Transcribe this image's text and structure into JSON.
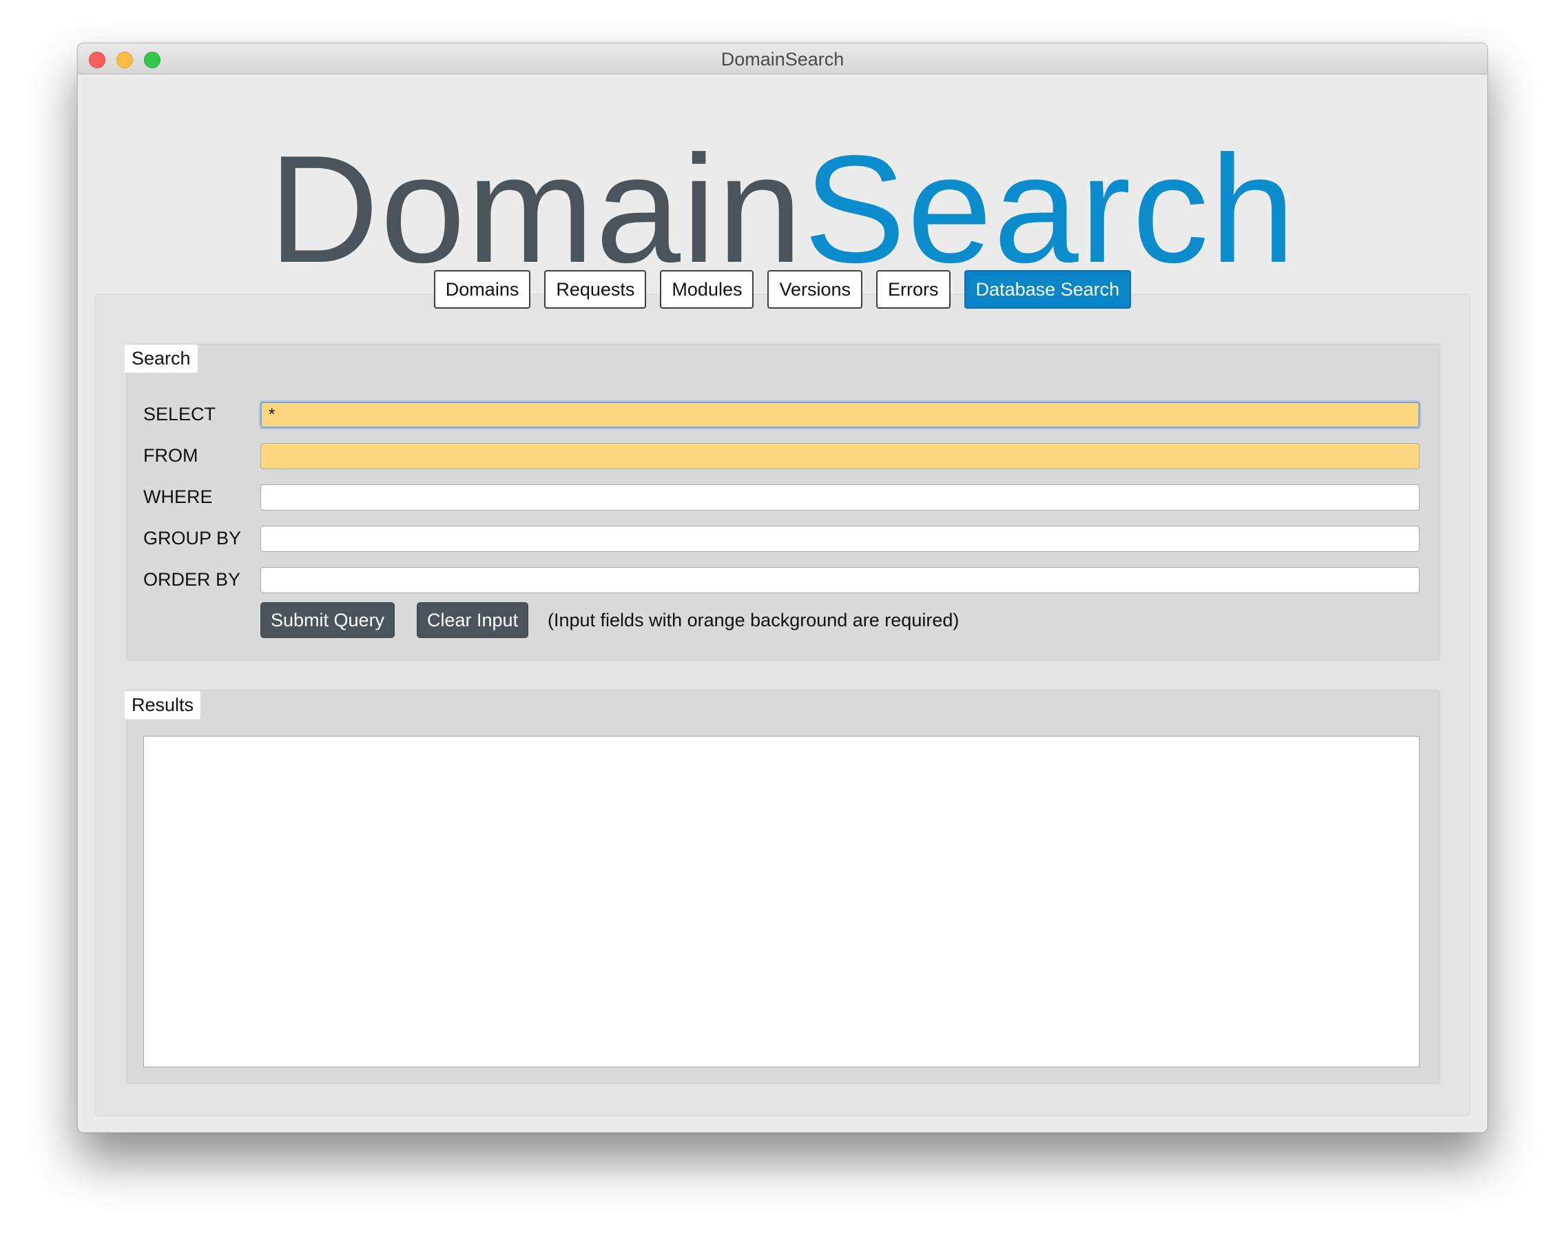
{
  "window": {
    "title": "DomainSearch"
  },
  "logo": {
    "part1": "Domain",
    "part2": "Search",
    "color_dark": "#4b545b",
    "color_accent": "#0a8ccd"
  },
  "tabs": [
    {
      "label": "Domains",
      "active": false
    },
    {
      "label": "Requests",
      "active": false
    },
    {
      "label": "Modules",
      "active": false
    },
    {
      "label": "Versions",
      "active": false
    },
    {
      "label": "Errors",
      "active": false
    },
    {
      "label": "Database Search",
      "active": true
    }
  ],
  "search": {
    "legend": "Search",
    "fields": {
      "select": {
        "label": "SELECT",
        "value": "*",
        "required": true
      },
      "from": {
        "label": "FROM",
        "value": "",
        "required": true
      },
      "where": {
        "label": "WHERE",
        "value": "",
        "required": false
      },
      "group_by": {
        "label": "GROUP BY",
        "value": "",
        "required": false
      },
      "order_by": {
        "label": "ORDER BY",
        "value": "",
        "required": false
      }
    },
    "submit_label": "Submit Query",
    "clear_label": "Clear Input",
    "hint": "(Input fields with orange background are required)",
    "required_color": "#fdd780"
  },
  "results": {
    "legend": "Results",
    "content": ""
  }
}
